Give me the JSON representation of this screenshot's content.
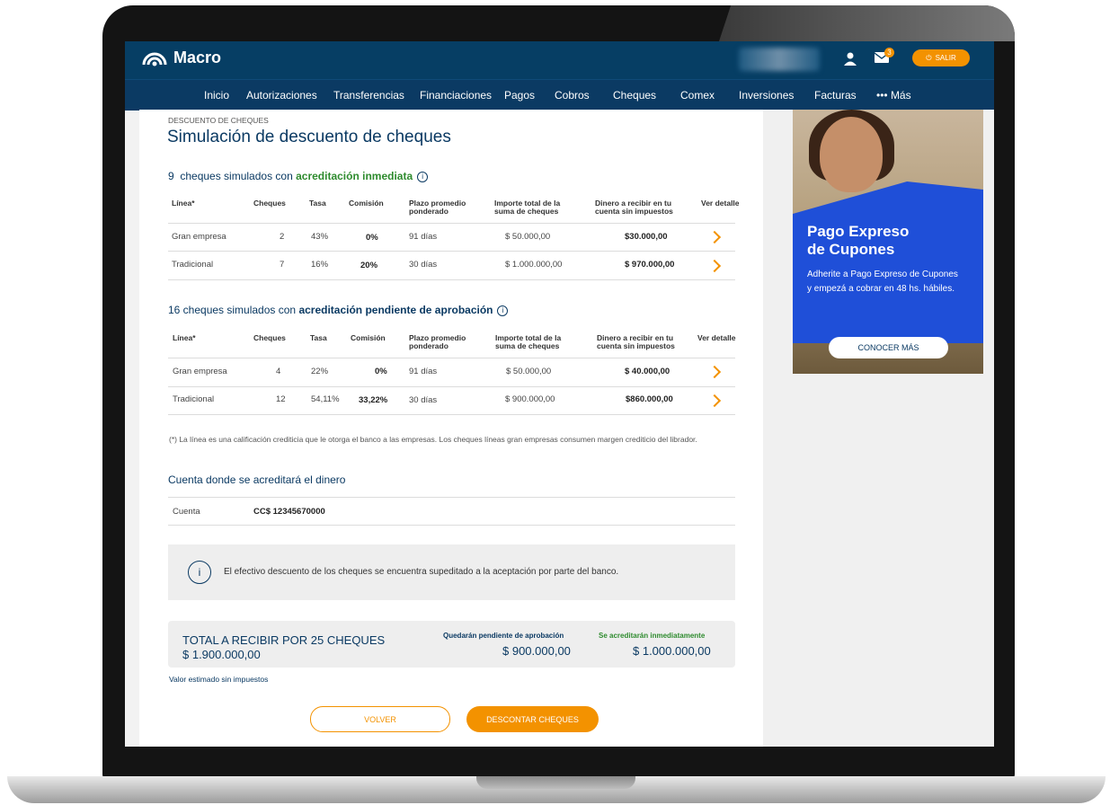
{
  "header": {
    "brand": "Macro",
    "mail_badge": "3",
    "exit_label": "SALIR"
  },
  "nav": [
    "Inicio",
    "Autorizaciones",
    "Transferencias",
    "Financiaciones",
    "Pagos",
    "Cobros",
    "Cheques",
    "Comex",
    "Inversiones",
    "Facturas",
    "••• Más"
  ],
  "page": {
    "breadcrumb": "DESCUENTO DE CHEQUES",
    "title": "Simulación de descuento de cheques"
  },
  "section1": {
    "prefix": "9  cheques simulados con ",
    "highlight": "acreditación inmediata",
    "headers": [
      "Línea*",
      "Cheques",
      "Tasa",
      "Comisión",
      "Plazo promedio ponderado",
      "Importe total de la suma de cheques",
      "Dinero a recibir en tu cuenta sin impuestos",
      "Ver detalle"
    ],
    "rows": [
      {
        "linea": "Gran empresa",
        "cheques": "2",
        "tasa": "43%",
        "comision": "0%",
        "plazo": "91 días",
        "importe": "$ 50.000,00",
        "dinero": "$30.000,00"
      },
      {
        "linea": "Tradicional",
        "cheques": "7",
        "tasa": "16%",
        "comision": "20%",
        "plazo": "30 días",
        "importe": "$ 1.000.000,00",
        "dinero": "$ 970.000,00"
      }
    ]
  },
  "section2": {
    "prefix": "16 cheques simulados con ",
    "highlight": "acreditación pendiente de aprobación",
    "headers": [
      "Línea*",
      "Cheques",
      "Tasa",
      "Comisión",
      "Plazo promedio ponderado",
      "Importe total de la suma de cheques",
      "Dinero a recibir en tu cuenta sin impuestos",
      "Ver detalle"
    ],
    "rows": [
      {
        "linea": "Gran empresa",
        "cheques": "4",
        "tasa": "22%",
        "comision": "0%",
        "plazo": "91 días",
        "importe": "$ 50.000,00",
        "dinero": "$ 40.000,00"
      },
      {
        "linea": "Tradicional",
        "cheques": "12",
        "tasa": "54,11%",
        "comision": "33,22%",
        "plazo": "30 días",
        "importe": "$ 900.000,00",
        "dinero": "$860.000,00"
      }
    ]
  },
  "footnote": "(*) La línea es una calificación crediticia que le otorga el banco a las empresas. Los cheques líneas gran empresas consumen margen crediticio del librador.",
  "account": {
    "title": "Cuenta donde se acreditará el dinero",
    "label": "Cuenta",
    "value": "CC$ 12345670000"
  },
  "notice": {
    "icon": "i",
    "text": "El efectivo descuento de los cheques se encuentra supeditado a la aceptación por parte del banco."
  },
  "total": {
    "title": "TOTAL A RECIBIR POR 25 CHEQUES",
    "amount": "$ 1.900.000,00",
    "pending_label": "Quedarán pendiente de aprobación",
    "pending_amount": "$ 900.000,00",
    "immediate_label": "Se acreditarán inmediatamente",
    "immediate_amount": "$ 1.000.000,00",
    "note": "Valor estimado sin impuestos"
  },
  "buttons": {
    "back": "VOLVER",
    "discount": "DESCONTAR CHEQUES"
  },
  "ad": {
    "title_line1": "Pago Expreso",
    "title_line2": "de Cupones",
    "text": "Adherite a Pago Expreso de Cupones y empezá a cobrar en 48 hs. hábiles.",
    "button": "CONOCER MÁS"
  },
  "colors": {
    "navy": "#063e64",
    "orange": "#f39200",
    "green": "#2e8b2e",
    "ad_blue": "#1f4fd8"
  }
}
